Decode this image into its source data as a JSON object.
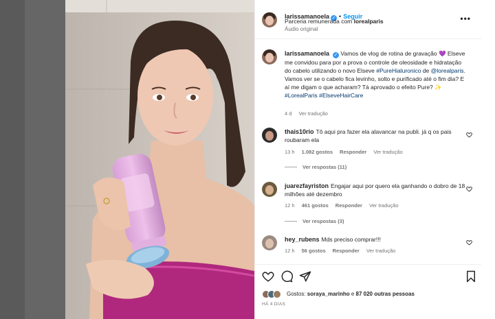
{
  "post": {
    "author": {
      "username": "larissamanoela",
      "follow_label": "Seguir",
      "separator": "•",
      "partnership_prefix": "Parceria remunerada com ",
      "partner": "lorealparis",
      "audio": "Áudio original",
      "more_icon": "more-horizontal-icon"
    },
    "caption": {
      "username": "larissamanoela",
      "text_1": "Vamos de vlog de rotina de gravação 💜 Elseve me convidou para por a prova o controle de oleosidade e hidratação do cabelo utilizando o novo Elseve ",
      "tag_1": "#PureHialuronico",
      "text_2": " de ",
      "mention": "@lorealparis",
      "text_3": ". Vamos ver se o cabelo fica levinho, solto e purificado até o fim dia? E aí me digam o que acharam? Tá aprovado o efeito Pure? ✨",
      "tag_2": "#LorealParis",
      "tag_3": "#ElseveHairCare",
      "time": "4 d",
      "translate": "Ver tradução"
    },
    "comments": [
      {
        "username": "thais10rio",
        "text": "Tô aqui pra fazer ela alavancar na publi. já q os pais roubaram ela",
        "time": "13 h",
        "likes": "1.082 gostos",
        "reply": "Responder",
        "translate": "Ver tradução",
        "view_replies": "Ver respostas (11)"
      },
      {
        "username": "juarezfayriston",
        "text": "Engajar aqui por quero ela ganhando o dobro de 18 milhões até dezembro",
        "time": "12 h",
        "likes": "461 gostos",
        "reply": "Responder",
        "translate": "Ver tradução",
        "view_replies": "Ver respostas (3)"
      },
      {
        "username": "hey_rubens",
        "text": "Mds preciso comprar!!!",
        "time": "12 h",
        "likes": "56 gostos",
        "reply": "Responder",
        "translate": "Ver tradução"
      }
    ],
    "actions": {
      "like_icon": "heart-icon",
      "comment_icon": "comment-icon",
      "share_icon": "share-icon",
      "save_icon": "bookmark-icon"
    },
    "likes_prefix": "Gostos: ",
    "likes_user": "soraya_marinho",
    "likes_suffix": " e ",
    "likes_count": "87 020 outras pessoas",
    "posted_ago": "HÁ 4 DIAS"
  },
  "colors": {
    "accent": "#0095f6",
    "verified": "#3897f0",
    "hashtag": "#00376b",
    "muted": "#737373"
  }
}
